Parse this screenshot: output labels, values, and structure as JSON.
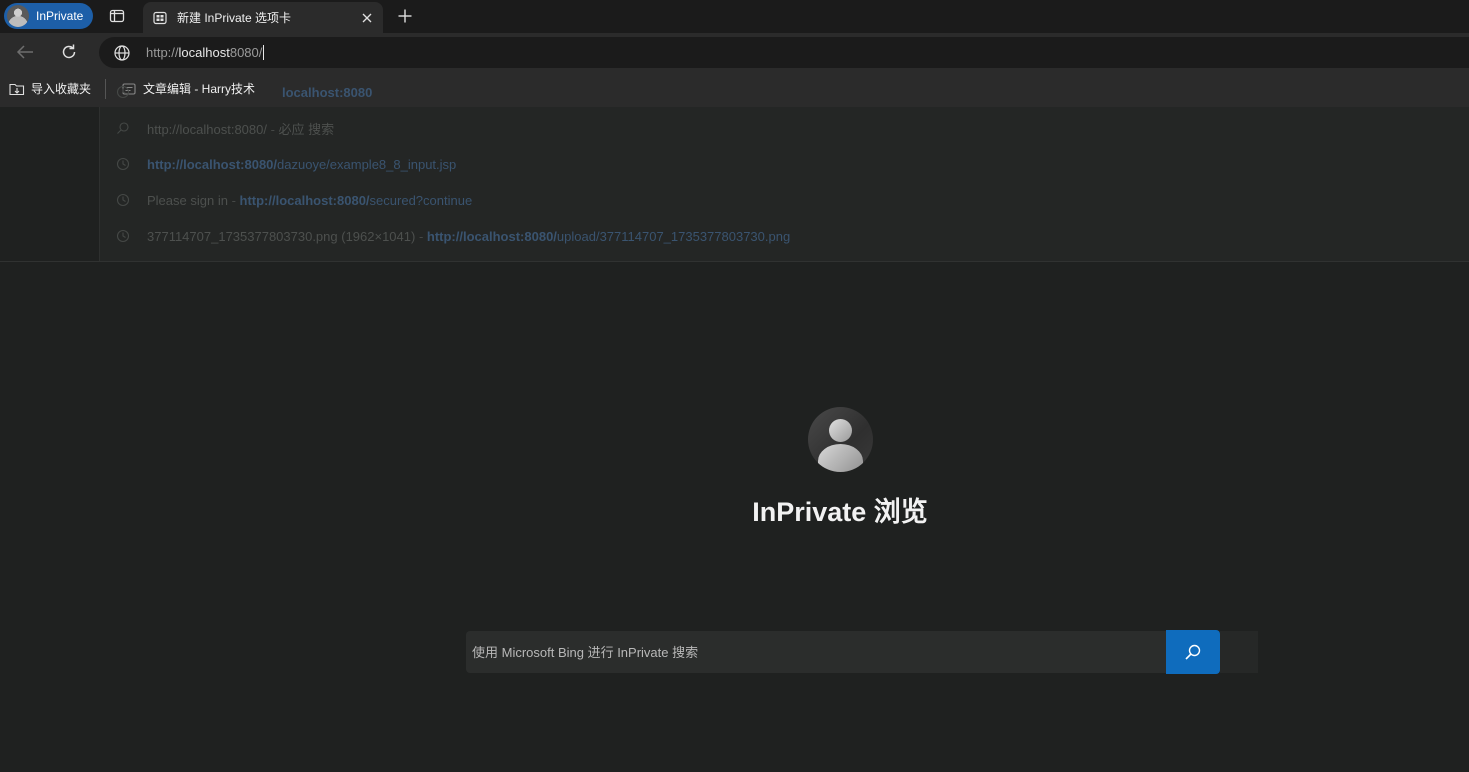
{
  "tabstrip": {
    "profile_label": "InPrivate",
    "tab_title": "新建 InPrivate 选项卡"
  },
  "toolbar": {
    "address_prefix": "http://",
    "address_host": "localhost",
    "address_rest": "8080/"
  },
  "favorites": {
    "import_label": "导入收藏夹",
    "item_label": "文章编辑 - Harry技术"
  },
  "suggestions": [
    {
      "icon": "history-icon",
      "plain": "",
      "link": "localhost:8080",
      "path": ""
    },
    {
      "icon": "search-icon",
      "plain": "http://localhost:8080/",
      "sep": " - ",
      "extra": "必应 搜索"
    },
    {
      "icon": "history-icon",
      "link": "http://localhost:8080/",
      "path": "dazuoye/example8_8_input.jsp"
    },
    {
      "icon": "history-icon",
      "plain": "Please sign in",
      "sep": " - ",
      "link": "http://localhost:8080/",
      "path": "secured?continue"
    },
    {
      "icon": "history-icon",
      "plain": "377114707_1735377803730.png (1962×1041)",
      "sep": " - ",
      "link": "http://localhost:8080/",
      "path": "upload/377114707_1735377803730.png"
    }
  ],
  "main": {
    "title": "InPrivate 浏览",
    "search_placeholder": "使用 Microsoft Bing 进行 InPrivate 搜索"
  },
  "colors": {
    "accent": "#0f6cbd",
    "profile_pill": "#1d5fa8",
    "background": "#1f2120"
  }
}
